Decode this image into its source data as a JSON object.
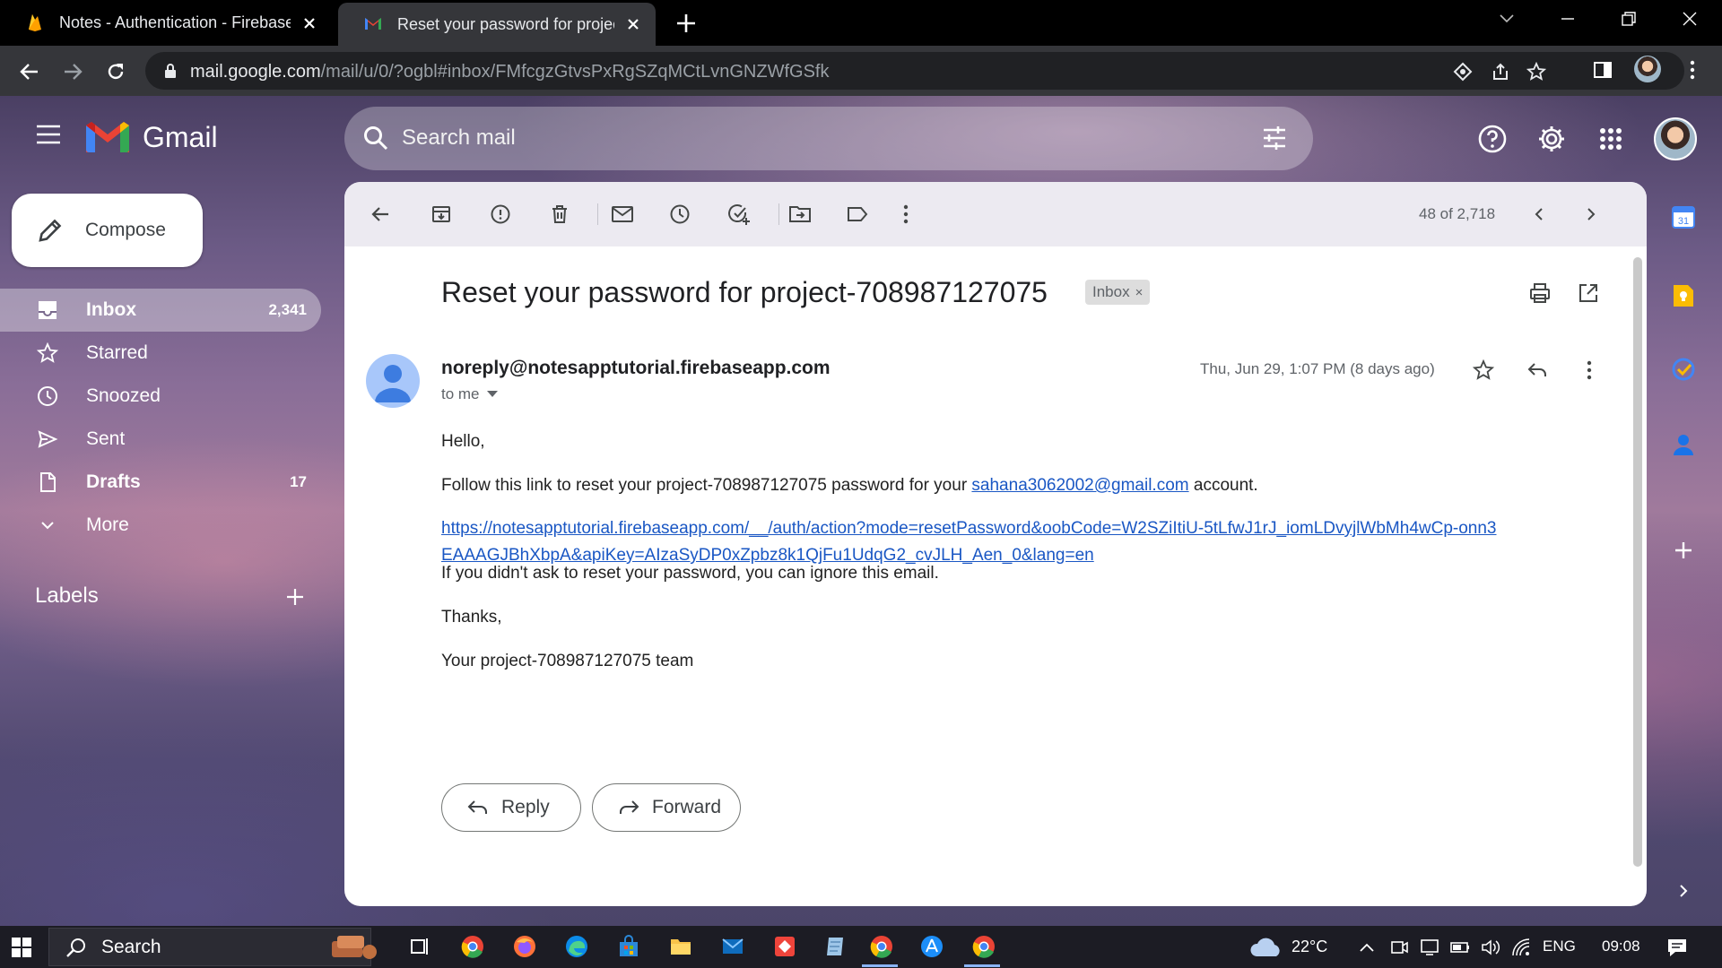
{
  "browser": {
    "tabs": [
      {
        "title": "Notes - Authentication - Firebase",
        "favicon": "firebase-icon",
        "active": false
      },
      {
        "title": "Reset your password for project-",
        "favicon": "gmail-icon",
        "active": true
      }
    ],
    "url_host": "mail.google.com",
    "url_path": "/mail/u/0/?ogbl#inbox/FMfcgzGtvsPxRgSZqMCtLvnGNZWfGSfk"
  },
  "gmail": {
    "brand": "Gmail",
    "search_placeholder": "Search mail",
    "compose_label": "Compose",
    "nav": [
      {
        "label": "Inbox",
        "count": "2,341",
        "icon": "inbox-icon"
      },
      {
        "label": "Starred",
        "count": "",
        "icon": "star-icon"
      },
      {
        "label": "Snoozed",
        "count": "",
        "icon": "clock-icon"
      },
      {
        "label": "Sent",
        "count": "",
        "icon": "send-icon"
      },
      {
        "label": "Drafts",
        "count": "17",
        "icon": "draft-icon"
      },
      {
        "label": "More",
        "count": "",
        "icon": "chevron-down-icon"
      }
    ],
    "labels_heading": "Labels",
    "pager": "48 of 2,718"
  },
  "email": {
    "subject": "Reset your password for project-708987127075",
    "chip": "Inbox",
    "chip_close": "×",
    "sender": "noreply@notesapptutorial.firebaseapp.com",
    "to": "to me",
    "date": "Thu, Jun 29, 1:07 PM (8 days ago)",
    "greeting": "Hello,",
    "line1_pre": "Follow this link to reset your project-708987127075 password for your ",
    "line1_email": "sahana3062002@gmail.com",
    "line1_post": " account.",
    "link": "https://notesapptutorial.firebaseapp.com/__/auth/action?mode=resetPassword&oobCode=W2SZiItiU-5tLfwJ1rJ_iomLDvyjlWbMh4wCp-onn3EAAAGJBhXbpA&apiKey=AIzaSyDP0xZpbz8k1QjFu1UdqG2_cvJLH_Aen_0&lang=en",
    "line3": "If you didn't ask to reset your password, you can ignore this email.",
    "thanks": "Thanks,",
    "signoff": "Your project-708987127075 team",
    "reply_label": "Reply",
    "forward_label": "Forward"
  },
  "taskbar": {
    "search_label": "Search",
    "weather": "22°C",
    "language": "ENG",
    "time": "09:08"
  },
  "colors": {
    "link": "#1a57c4",
    "gmail_red": "#ea4335",
    "chip_bg": "#dddddd"
  }
}
